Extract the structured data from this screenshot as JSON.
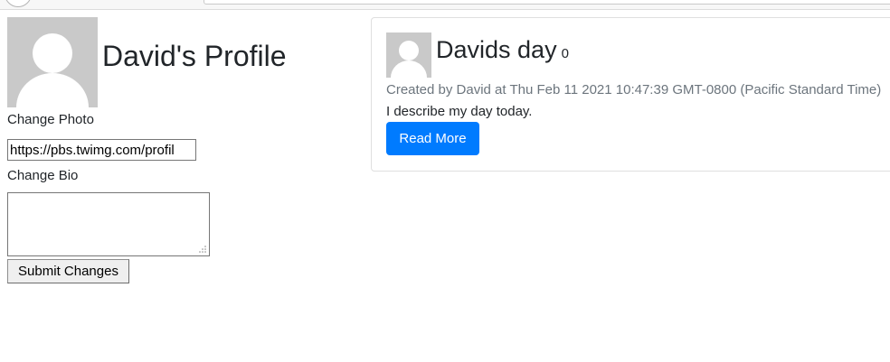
{
  "profile": {
    "title": "David's Profile",
    "change_photo_label": "Change Photo",
    "photo_url_value": "https://pbs.twimg.com/profil",
    "change_bio_label": "Change Bio",
    "bio_value": "",
    "submit_label": "Submit Changes"
  },
  "post": {
    "title": "Davids day",
    "count": "0",
    "meta": "Created by David at Thu Feb 11 2021 10:47:39 GMT-0800 (Pacific Standard Time)",
    "body": "I describe my day today.",
    "read_more_label": "Read More"
  },
  "colors": {
    "primary_button": "#007bff",
    "muted_text": "#6c757d",
    "avatar_placeholder": "#c9c9c9"
  },
  "icons": {
    "avatar": "default-user-avatar-icon"
  }
}
